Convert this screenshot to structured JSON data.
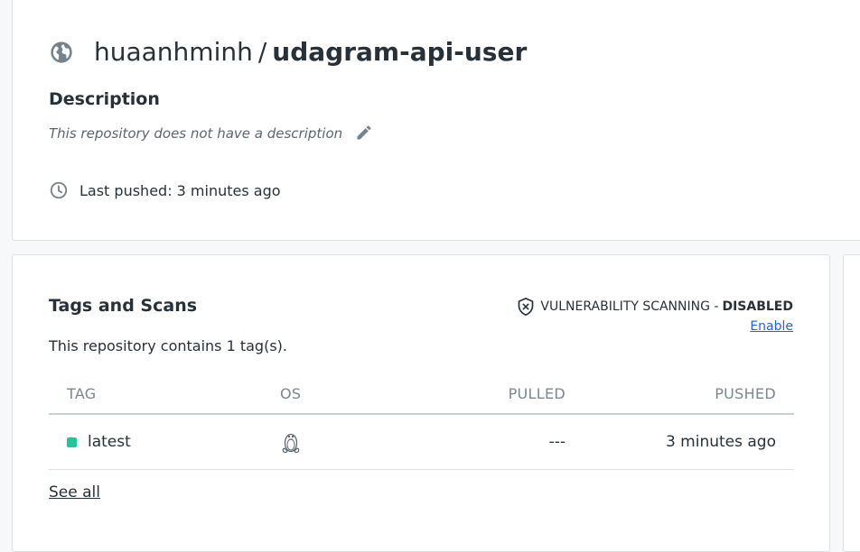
{
  "header": {
    "namespace": "huaanhminh",
    "separator": "/",
    "repository": "udagram-api-user",
    "visibility_icon": "globe-icon",
    "description_heading": "Description",
    "description_text": "This repository does not have a description",
    "edit_icon": "pencil-icon",
    "last_pushed_label": "Last pushed: 3 minutes ago",
    "clock_icon": "clock-icon"
  },
  "tags": {
    "heading": "Tags and Scans",
    "count_text": "This repository contains 1 tag(s).",
    "vulnerability": {
      "label": "VULNERABILITY SCANNING - ",
      "status": "DISABLED",
      "enable_link": "Enable",
      "icon": "shield-icon"
    },
    "columns": [
      "TAG",
      "OS",
      "PULLED",
      "PUSHED"
    ],
    "rows": [
      {
        "tag": "latest",
        "os_icon": "linux-tux-icon",
        "pulled": "---",
        "pushed": "3 minutes ago",
        "status_color": "#25c49b"
      }
    ],
    "see_all": "See all"
  },
  "colors": {
    "accent_link": "#1d63ed",
    "text": "#27313a",
    "muted": "#7a8690",
    "tag_status": "#25c49b"
  }
}
